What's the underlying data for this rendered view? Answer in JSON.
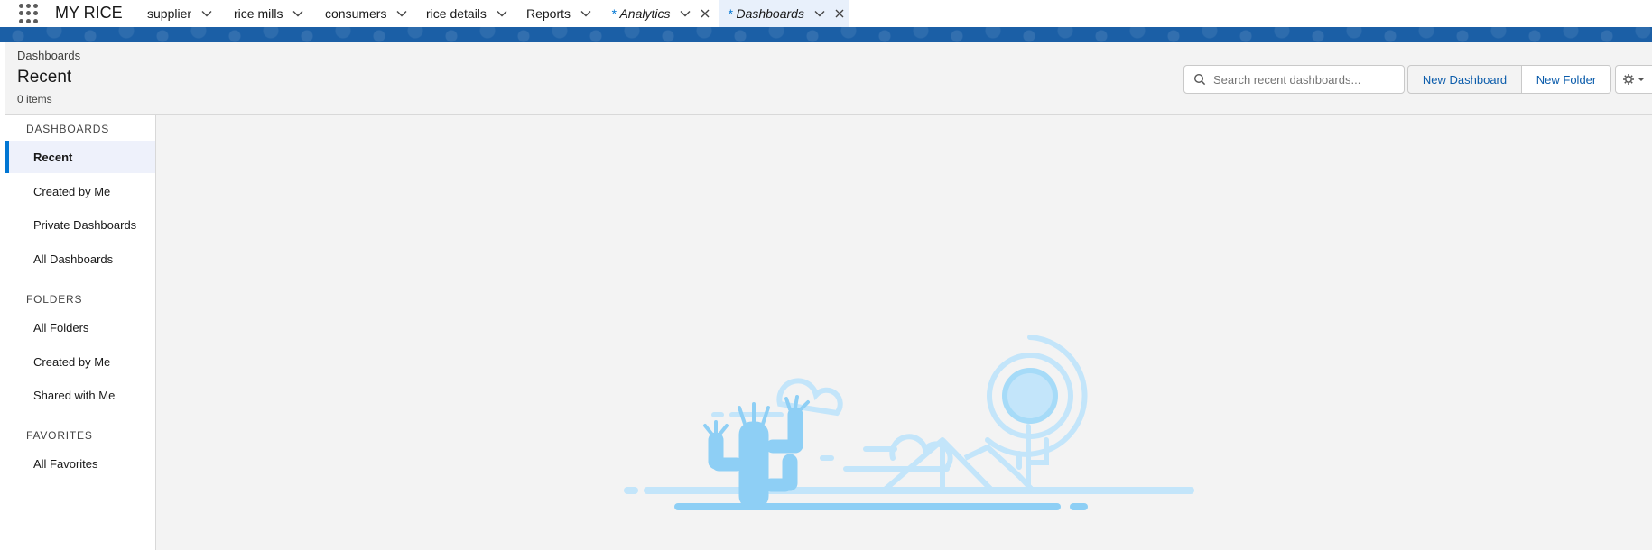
{
  "app": {
    "name": "MY RICE"
  },
  "nav": {
    "items": [
      {
        "label": "supplier"
      },
      {
        "label": "rice mills"
      },
      {
        "label": "consumers"
      },
      {
        "label": "rice details"
      },
      {
        "label": "Reports"
      }
    ],
    "tabs": [
      {
        "star": "*",
        "label": "Analytics"
      },
      {
        "star": "*",
        "label": "Dashboards"
      }
    ]
  },
  "header": {
    "breadcrumb": "Dashboards",
    "title": "Recent",
    "count": "0 items",
    "search_placeholder": "Search recent dashboards...",
    "search_value": "",
    "new_dashboard": "New Dashboard",
    "new_folder": "New Folder"
  },
  "sidebar": {
    "dashboards_title": "DASHBOARDS",
    "dashboards": [
      {
        "label": "Recent"
      },
      {
        "label": "Created by Me"
      },
      {
        "label": "Private Dashboards"
      },
      {
        "label": "All Dashboards"
      }
    ],
    "folders_title": "FOLDERS",
    "folders": [
      {
        "label": "All Folders"
      },
      {
        "label": "Created by Me"
      },
      {
        "label": "Shared with Me"
      }
    ],
    "favorites_title": "FAVORITES",
    "favorites": [
      {
        "label": "All Favorites"
      }
    ]
  },
  "colors": {
    "brand_band": "#1b5fa6",
    "link": "#0b5cab",
    "accent": "#0176d3",
    "illustration": "#8ecff5"
  },
  "icons": {
    "app_launcher": "waffle-icon",
    "dropdown": "chevron-down-icon",
    "close": "close-icon",
    "search": "search-icon",
    "settings": "gear-icon"
  }
}
